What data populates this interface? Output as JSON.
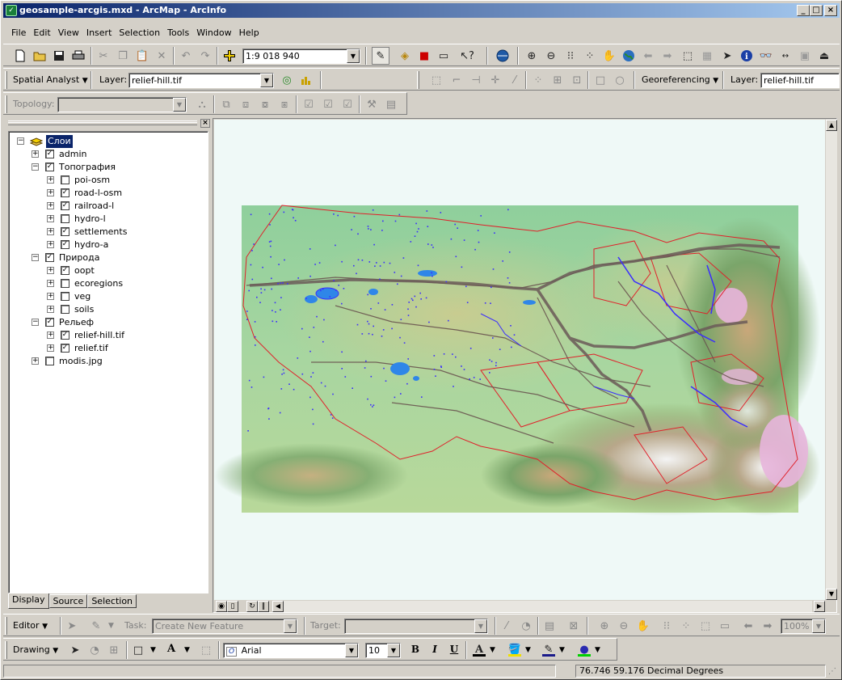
{
  "window": {
    "title": "geosample-arcgis.mxd - ArcMap - ArcInfo",
    "controls": {
      "minimize": "_",
      "maximize": "□",
      "close": "×"
    }
  },
  "menubar": {
    "items": [
      {
        "label": "File"
      },
      {
        "label": "Edit"
      },
      {
        "label": "View"
      },
      {
        "label": "Insert"
      },
      {
        "label": "Selection"
      },
      {
        "label": "Tools"
      },
      {
        "label": "Window"
      },
      {
        "label": "Help"
      }
    ]
  },
  "standard_toolbar": {
    "scale_value": "1:9 018 940"
  },
  "spatial_analyst": {
    "menu_label": "Spatial Analyst",
    "layer_label": "Layer:",
    "layer_value": "relief-hill.tif"
  },
  "georeferencing": {
    "menu_label": "Georeferencing",
    "layer_label": "Layer:",
    "layer_value": "relief-hill.tif"
  },
  "topology": {
    "label": "Topology:",
    "value": ""
  },
  "toc": {
    "root_label": "Слои",
    "layers": [
      {
        "label": "admin",
        "checked": true,
        "level": 1
      },
      {
        "label": "Топография",
        "checked": true,
        "level": 1,
        "expanded": true
      },
      {
        "label": "poi-osm",
        "checked": false,
        "level": 2
      },
      {
        "label": "road-l-osm",
        "checked": true,
        "level": 2
      },
      {
        "label": "railroad-l",
        "checked": true,
        "level": 2
      },
      {
        "label": "hydro-l",
        "checked": false,
        "level": 2
      },
      {
        "label": "settlements",
        "checked": true,
        "level": 2
      },
      {
        "label": "hydro-a",
        "checked": true,
        "level": 2
      },
      {
        "label": "Природа",
        "checked": true,
        "level": 1,
        "expanded": true
      },
      {
        "label": "oopt",
        "checked": true,
        "level": 2
      },
      {
        "label": "ecoregions",
        "checked": false,
        "level": 2
      },
      {
        "label": "veg",
        "checked": false,
        "level": 2
      },
      {
        "label": "soils",
        "checked": false,
        "level": 2
      },
      {
        "label": "Рельеф",
        "checked": true,
        "level": 1,
        "expanded": true
      },
      {
        "label": "relief-hill.tif",
        "checked": true,
        "level": 2
      },
      {
        "label": "relief.tif",
        "checked": true,
        "level": 2
      },
      {
        "label": "modis.jpg",
        "checked": false,
        "level": 1
      }
    ],
    "tabs": [
      {
        "label": "Display"
      },
      {
        "label": "Source"
      },
      {
        "label": "Selection"
      }
    ]
  },
  "editor": {
    "menu_label": "Editor",
    "task_label": "Task:",
    "task_value": "Create New Feature",
    "target_label": "Target:",
    "target_value": "",
    "zoom_value": "100%"
  },
  "drawing": {
    "menu_label": "Drawing",
    "font_value": "Arial",
    "size_value": "10",
    "bold": "B",
    "italic": "I",
    "underline": "U",
    "text_tool": "A"
  },
  "status": {
    "coordinates": "76.746  59.176 Decimal Degrees"
  },
  "colors": {
    "title_start": "#0a246a",
    "title_end": "#a6caf0",
    "chrome": "#d4d0c8",
    "map_background": "#eff9f7",
    "admin_boundary": "#e0202a",
    "hydro": "#3a2cff",
    "roads": "#6a5550"
  }
}
